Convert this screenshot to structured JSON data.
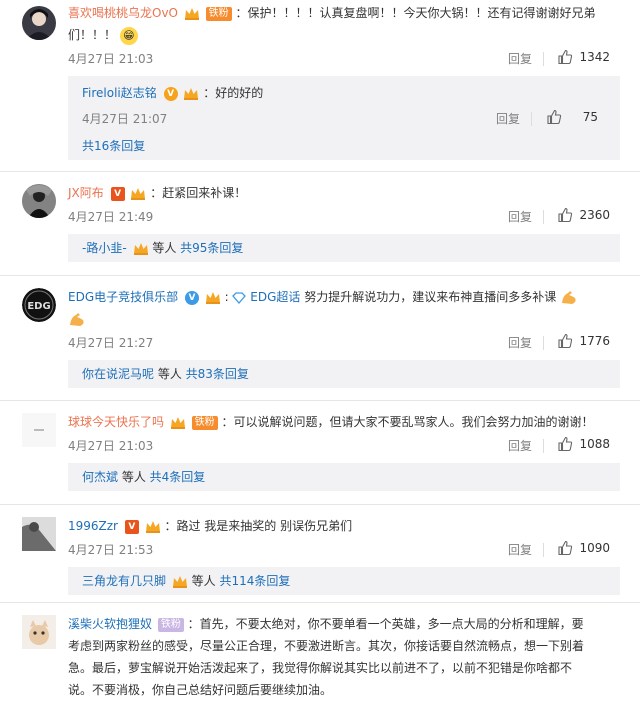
{
  "reply_label": "回复",
  "fan_badge": "铁粉",
  "comments": [
    {
      "user": "喜欢喝桃桃乌龙OvO",
      "text_a": "：保护！！！！认真复盘啊！！今天你大锅！！还有记得谢谢好兄弟",
      "text_b": "们！！！",
      "date": "4月27日 21:03",
      "likes": "1342",
      "sub_user": "Fireloli赵志铭",
      "sub_text": "：好的好的",
      "sub_date": "4月27日 21:07",
      "sub_likes": "75",
      "more": "共16条回复"
    },
    {
      "user": "JX阿布",
      "text": "：赶紧回来补课！",
      "date": "4月27日 21:49",
      "likes": "2360",
      "more_user": "-路小韭-",
      "more_tail": " 等人 ",
      "more_count": "共95条回复"
    },
    {
      "user": "EDG电子竞技俱乐部",
      "topic": "EDG超话",
      "text": " 努力提升解说功力，建议来布神直播间多多补课",
      "date": "4月27日 21:27",
      "likes": "1776",
      "more_user": "你在说泥马呢",
      "more_tail": " 等人 ",
      "more_count": "共83条回复"
    },
    {
      "user": "球球今天快乐了吗",
      "text": "：可以说解说问题，但请大家不要乱骂家人。我们会努力加油的谢谢！",
      "date": "4月27日 21:03",
      "likes": "1088",
      "more_user": "何杰斌",
      "more_tail": " 等人 ",
      "more_count": "共4条回复"
    },
    {
      "user": "1996Zzr",
      "text": "：路过 我是来抽奖的 别误伤兄弟们",
      "date": "4月27日 21:53",
      "likes": "1090",
      "more_user": "三角龙有几只脚",
      "more_tail": " 等人 ",
      "more_count": "共114条回复"
    },
    {
      "user": "溪柴火软抱狸奴",
      "text_a": "：首先，不要太绝对，你不要单看一个英雄，多一点大局的分析和理解，要",
      "text_b": "考虑到两家粉丝的感受，尽量公正合理，不要激进断言。其次，你接话要自然流畅点，想一下别着",
      "text_c": "急。最后，萝宝解说开始活泼起来了，我觉得你解说其实比以前进不了，以前不犯错是你啥都不",
      "text_d": "说。不要消极，你自己总结好问题后要继续加油。"
    }
  ]
}
